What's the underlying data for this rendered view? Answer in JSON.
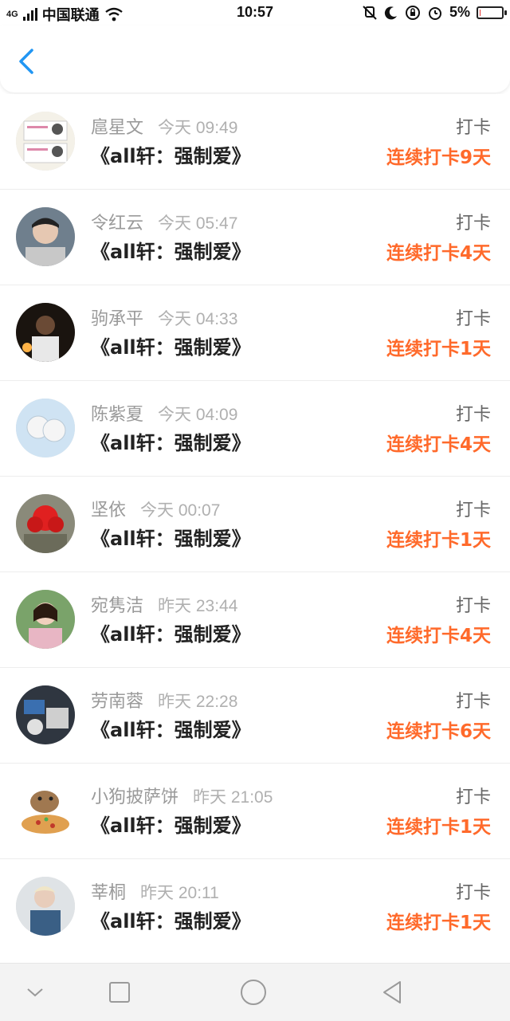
{
  "status_bar": {
    "network": "4G",
    "carrier": "中国联通",
    "time": "10:57",
    "battery": "5%",
    "battery_level": 0.05,
    "icons": [
      "signal-icon",
      "wifi-icon",
      "mute-icon",
      "moon-icon",
      "lock-rotation-icon",
      "alarm-icon",
      "battery-icon"
    ]
  },
  "header": {
    "back_icon": "chevron-left-icon",
    "accent_color": "#2196f3"
  },
  "records": [
    {
      "name": "扈星文",
      "time": "今天 09:49",
      "book": "《all轩：强制爱》",
      "action": "打卡",
      "streak": "连续打卡9天"
    },
    {
      "name": "令红云",
      "time": "今天 05:47",
      "book": "《all轩：强制爱》",
      "action": "打卡",
      "streak": "连续打卡4天"
    },
    {
      "name": "驹承平",
      "time": "今天 04:33",
      "book": "《all轩：强制爱》",
      "action": "打卡",
      "streak": "连续打卡1天"
    },
    {
      "name": "陈紫夏",
      "time": "今天 04:09",
      "book": "《all轩：强制爱》",
      "action": "打卡",
      "streak": "连续打卡4天"
    },
    {
      "name": "坚依",
      "time": "今天 00:07",
      "book": "《all轩：强制爱》",
      "action": "打卡",
      "streak": "连续打卡1天"
    },
    {
      "name": "宛隽洁",
      "time": "昨天 23:44",
      "book": "《all轩：强制爱》",
      "action": "打卡",
      "streak": "连续打卡4天"
    },
    {
      "name": "劳南蓉",
      "time": "昨天 22:28",
      "book": "《all轩：强制爱》",
      "action": "打卡",
      "streak": "连续打卡6天"
    },
    {
      "name": "小狗披萨饼",
      "time": "昨天 21:05",
      "book": "《all轩：强制爱》",
      "action": "打卡",
      "streak": "连续打卡1天"
    },
    {
      "name": "莘桐",
      "time": "昨天 20:11",
      "book": "《all轩：强制爱》",
      "action": "打卡",
      "streak": "连续打卡1天"
    }
  ],
  "colors": {
    "streak": "#ff6a2b",
    "name": "#9a9a9a",
    "book": "#222222"
  },
  "navbar": {
    "icons": [
      "nav-down-icon",
      "recent-apps-icon",
      "home-icon",
      "back-triangle-icon"
    ]
  }
}
